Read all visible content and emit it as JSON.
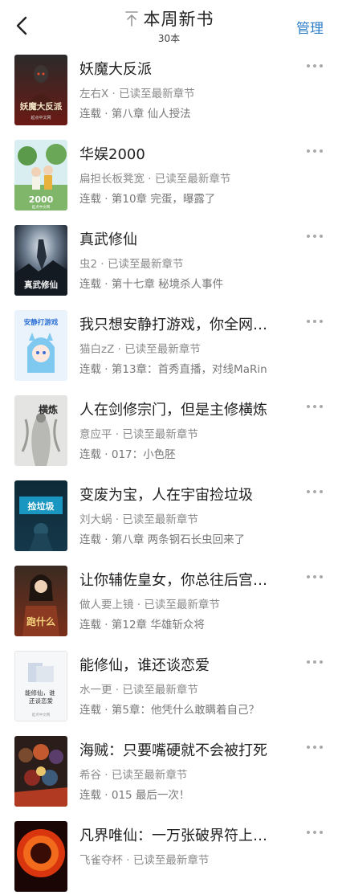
{
  "header": {
    "title": "本周新书",
    "count": "30本",
    "manage_label": "管理"
  },
  "books": [
    {
      "title": "妖魔大反派",
      "meta": "左右X · 已读至最新章节",
      "progress": "连载 · 第八章 仙人授法",
      "cover_text": "妖魔大反派",
      "cover_publisher": "起点中文网"
    },
    {
      "title": "华娱2000",
      "meta": "扁担长板凳宽 · 已读至最新章节",
      "progress": "连载 · 第10章 完蛋，曝露了",
      "cover_text": "2000",
      "cover_publisher": "起点中文网"
    },
    {
      "title": "真武修仙",
      "meta": "虫2 · 已读至最新章节",
      "progress": "连载 · 第十七章 秘境杀人事件",
      "cover_text": "真武修仙",
      "cover_publisher": ""
    },
    {
      "title": "我只想安静打游戏，你全网…",
      "meta": "猫白zZ · 已读至最新章节",
      "progress": "连载 · 第13章：首秀直播，对线MaRin",
      "cover_text": "安静打游戏",
      "cover_publisher": ""
    },
    {
      "title": "人在剑修宗门，但是主修横炼",
      "meta": "意应平 · 已读至最新章节",
      "progress": "连载 · 017：小色胚",
      "cover_text": "横炼",
      "cover_publisher": ""
    },
    {
      "title": "变废为宝，人在宇宙捡垃圾",
      "meta": "刘大蜗 · 已读至最新章节",
      "progress": "连载 · 第八章 两条钢石长虫回来了",
      "cover_text": "捡垃圾",
      "cover_publisher": ""
    },
    {
      "title": "让你辅佐皇女，你总往后宫…",
      "meta": "做人要上镜 · 已读至最新章节",
      "progress": "连载 · 第12章 华雄斩众将",
      "cover_text": "跑什么",
      "cover_publisher": ""
    },
    {
      "title": "能修仙，谁还谈恋爱",
      "meta": "水一更 · 已读至最新章节",
      "progress": "连载 · 第5章：他凭什么敢瞒着自己？",
      "cover_text": "能修仙，谁\n还谈恋爱",
      "cover_publisher": "起点中文网"
    },
    {
      "title": "海贼：只要嘴硬就不会被打死",
      "meta": "希谷 · 已读至最新章节",
      "progress": "连载 · 015 最后一次！",
      "cover_text": "",
      "cover_publisher": ""
    },
    {
      "title": "凡界唯仙：一万张破界符上…",
      "meta": "飞雀夺杯 · 已读至最新章节",
      "progress": "",
      "cover_text": "",
      "cover_publisher": ""
    }
  ]
}
